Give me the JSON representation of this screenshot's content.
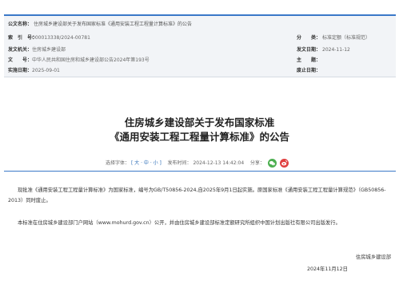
{
  "meta": {
    "index_label": "公文名称：",
    "index_value": "住房城乡建设部关于发布国家标准《通用安装工程工程量计算标准》的公告",
    "row1": {
      "label1": "索　引　号：",
      "value1": "000013338/2024-00781",
      "label2": "分　　类：",
      "value2": "标准定额（标准规范）"
    },
    "row2": {
      "label1": "发文机关：",
      "value1": "住房城乡建设部",
      "label2": "发文日期：",
      "value2": "2024-11-12"
    },
    "row3": {
      "label1": "文　　号：",
      "value1": "中华人民共和国住房和城乡建设部公告2024年第193号",
      "label2": "主　　题：",
      "value2": ""
    },
    "row4": {
      "label1": "实施日期：",
      "value1": "2025-09-01",
      "label2": "废止日期：",
      "value2": ""
    }
  },
  "article": {
    "title_line1": "住房城乡建设部关于发布国家标准",
    "title_line2": "《通用安装工程工程量计算标准》的公告",
    "font_size_label": "选择字体：",
    "font_size_options": "[ 大 · 中 · 小 ]",
    "publish_label": "发布时间：",
    "publish_time": "2024-12-13 14:42:04",
    "share_label": "分享：",
    "paragraph1": "现批准《通用安装工程工程量计算标准》为国家标准，编号为GB/T50856-2024,自2025年9月1日起实施。原国家标准《通用安装工程工程量计算规范》（GB50856-2013）同时废止。",
    "paragraph2": "本标准在住房城乡建设部门户网站（www.mohurd.gov.cn）公开，并由住房城乡建设部标准定额研究所组织中国计划出版社有限公司出版发行。",
    "signature": "住房城乡建设部",
    "date": "2024年11月12日"
  },
  "colors": {
    "accent": "#3a78c8",
    "meta_bg": "#f2f4f7",
    "wechat": "#4caf50",
    "weibo": "#e04040"
  }
}
